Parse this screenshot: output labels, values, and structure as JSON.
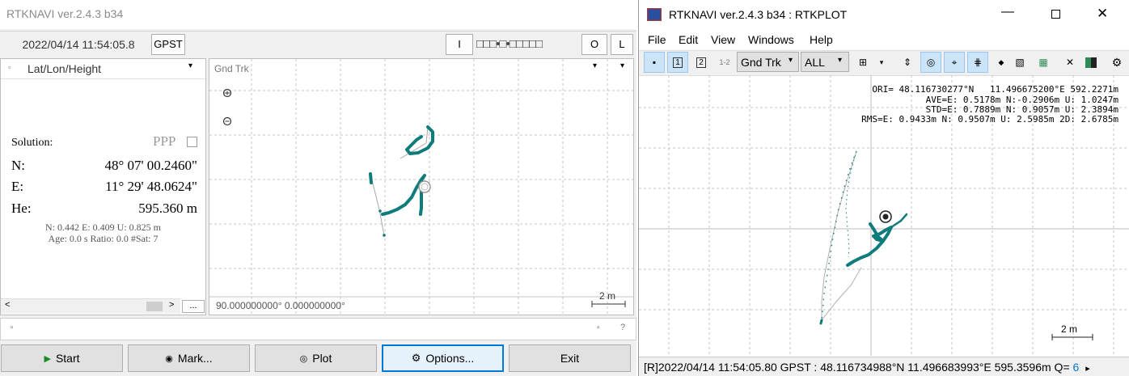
{
  "rtknavi": {
    "title": "RTKNAVI ver.2.4.3 b34",
    "time": "2022/04/14 11:54:05.8",
    "time_system": "GPST",
    "stream_in": "I",
    "stream_indicator": "□□□•□•□□□□□",
    "stream_out": "O",
    "stream_log": "L",
    "solution_panel": {
      "dropdown": "Lat/Lon/Height",
      "solution_label": "Solution:",
      "mode": "PPP",
      "rows": [
        {
          "label": "N:",
          "value": "48° 07' 00.2460\""
        },
        {
          "label": "E:",
          "value": "11° 29' 48.0624\""
        },
        {
          "label": "He:",
          "value": "595.360 m"
        }
      ],
      "stats_line1": "N: 0.442 E: 0.409 U: 0.825 m",
      "stats_line2": "Age: 0.0 s Ratio: 0.0 #Sat: 7",
      "more_button": "..."
    },
    "plot_panel": {
      "dropdown": "Gnd Trk",
      "origin": "90.000000000° 0.000000000°",
      "scale": "2 m"
    },
    "buttons": {
      "start": "Start",
      "mark": "Mark...",
      "plot": "Plot",
      "options": "Options...",
      "exit": "Exit"
    }
  },
  "rtkplot": {
    "title": "RTKNAVI ver.2.4.3 b34 : RTKPLOT",
    "menu": [
      "File",
      "Edit",
      "View",
      "Windows",
      "Help"
    ],
    "toolbar": {
      "plot_type": "Gnd Trk",
      "sat_filter": "ALL",
      "btn1": "1",
      "btn2": "2",
      "btn12": "1-2"
    },
    "stats": {
      "ori": "ORI= 48.116730277°N   11.496675200°E 592.2271m",
      "ave": "AVE=E: 0.5178m N:-0.2906m U: 1.0247m",
      "std": "STD=E: 0.7889m N: 0.9057m U: 2.3894m",
      "rms": "RMS=E: 0.9433m N: 0.9507m U: 2.5985m 2D: 2.6785m"
    },
    "scale": "2 m",
    "status": {
      "text": "[R]2022/04/14 11:54:05.80 GPST :  48.116734988°N    11.496683993°E   595.3596m  Q=",
      "q_value": "6",
      "arrow": "▸"
    }
  },
  "colors": {
    "track": "#0e7c7b",
    "accent": "#0078d7",
    "selected_bg": "#cce4f7"
  }
}
